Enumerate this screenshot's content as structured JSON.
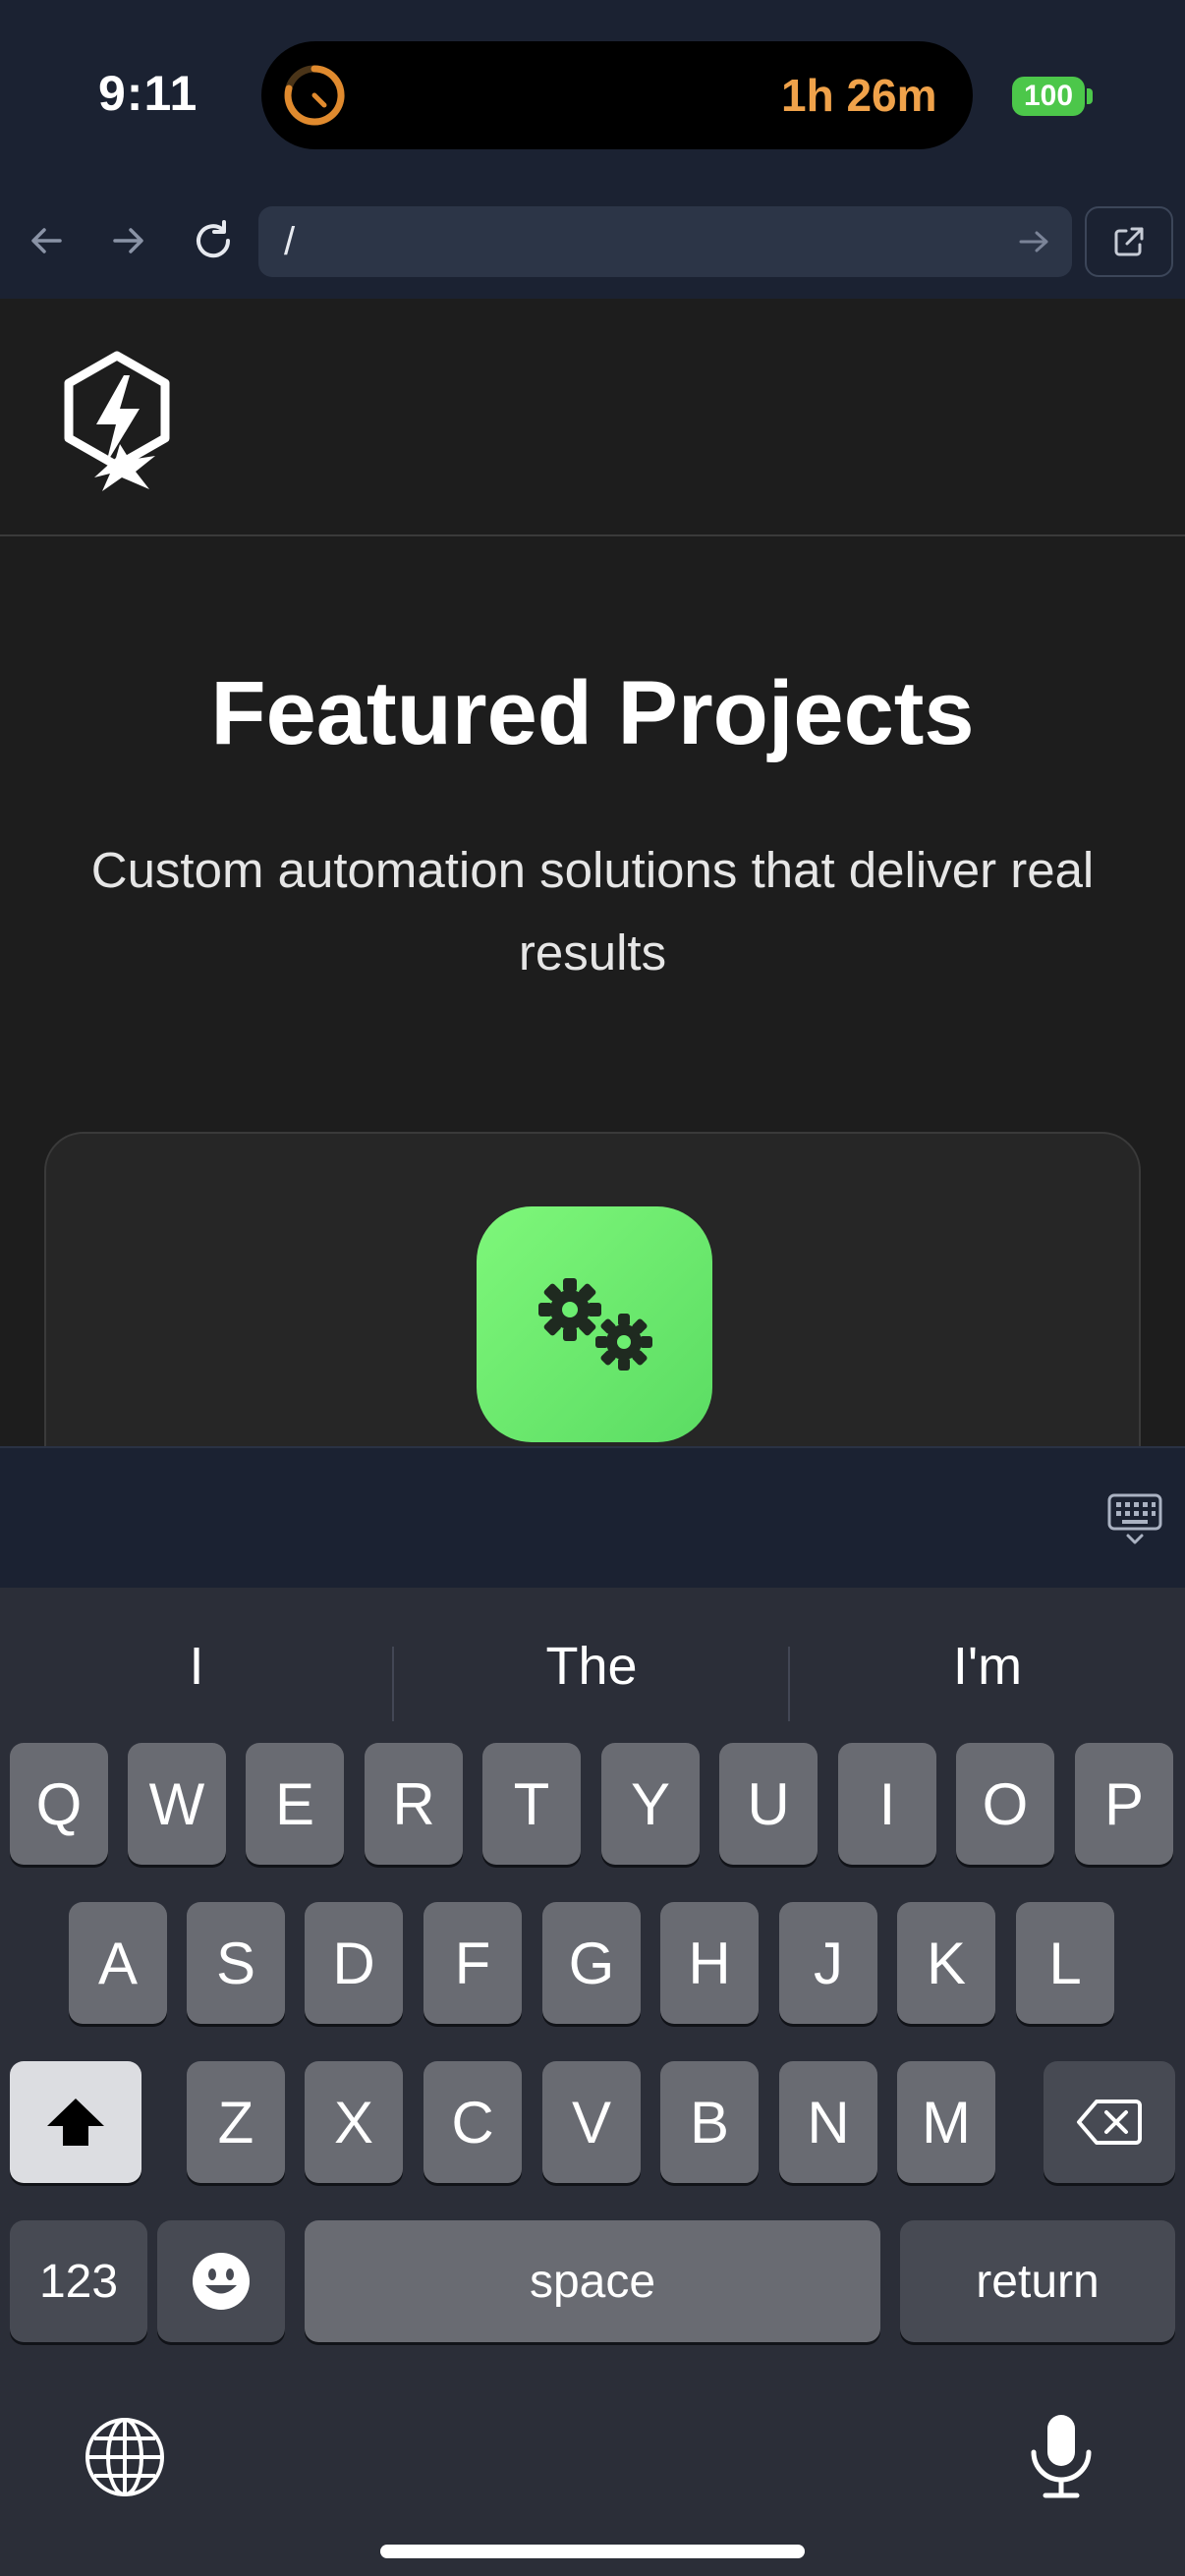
{
  "status_bar": {
    "time": "9:11",
    "timer": "1h 26m",
    "battery": "100"
  },
  "browser": {
    "url": "/"
  },
  "page": {
    "hero_title": "Featured Projects",
    "hero_subtitle": "Custom automation solutions that deliver real results"
  },
  "keyboard": {
    "suggestions": [
      "I",
      "The",
      "I'm"
    ],
    "row1": [
      "Q",
      "W",
      "E",
      "R",
      "T",
      "Y",
      "U",
      "I",
      "O",
      "P"
    ],
    "row2": [
      "A",
      "S",
      "D",
      "F",
      "G",
      "H",
      "J",
      "K",
      "L"
    ],
    "row3": [
      "Z",
      "X",
      "C",
      "V",
      "B",
      "N",
      "M"
    ],
    "numbers_label": "123",
    "space_label": "space",
    "return_label": "return"
  },
  "colors": {
    "accent_green": "#6cee70",
    "timer_orange": "#f0a24a",
    "battery_green": "#4cc74a"
  }
}
